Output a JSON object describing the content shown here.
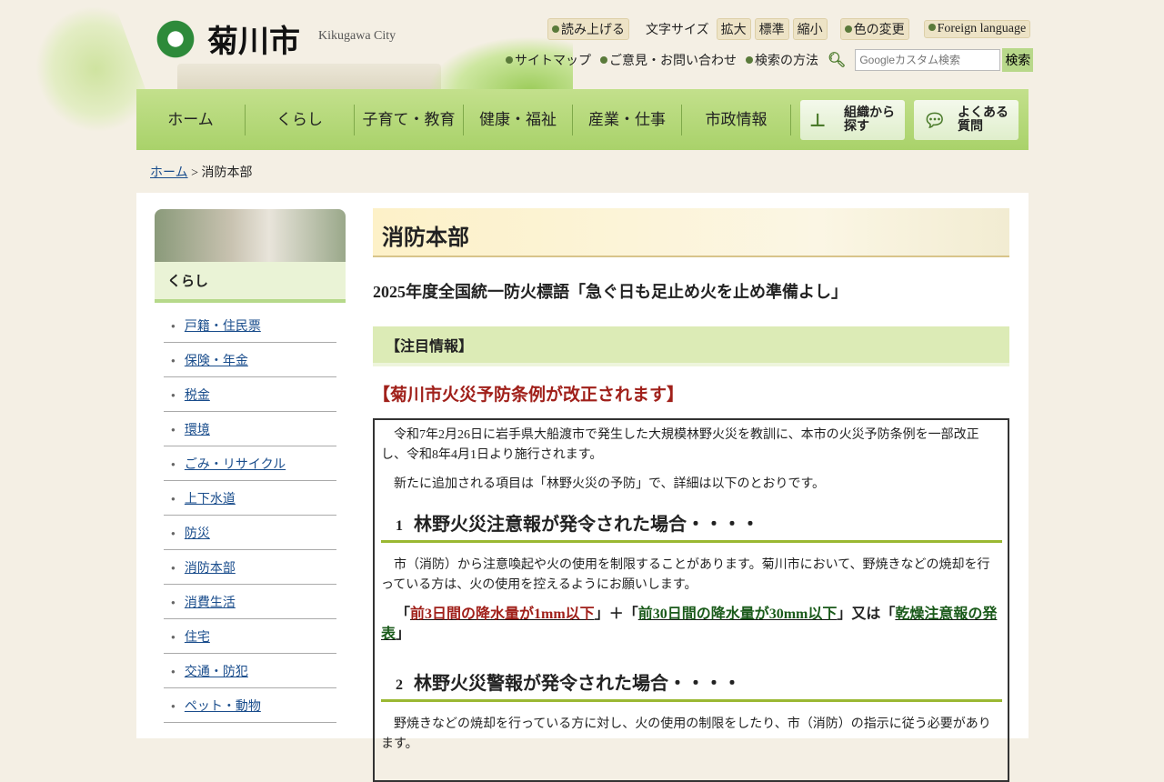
{
  "header": {
    "logo_text": "菊川市",
    "logo_en": "Kikugawa City",
    "read_aloud": "読み上げる",
    "font_size_label": "文字サイズ",
    "font_large": "拡大",
    "font_normal": "標準",
    "font_small": "縮小",
    "color_change": "色の変更",
    "foreign": "Foreign language",
    "sitemap": "サイトマップ",
    "contact": "ご意見・お問い合わせ",
    "search_help": "検索の方法",
    "search_placeholder": "Googleカスタム検索",
    "search_button": "検索"
  },
  "nav": {
    "items": [
      "ホーム",
      "くらし",
      "子育て・教育",
      "健康・福祉",
      "産業・仕事",
      "市政情報"
    ],
    "org": "組織から\n探す",
    "faq": "よくある\n質問"
  },
  "breadcrumb": {
    "home": "ホーム",
    "sep": " > ",
    "current": "消防本部"
  },
  "sidebar": {
    "title": "くらし",
    "items": [
      "戸籍・住民票",
      "保険・年金",
      "税金",
      "環境",
      "ごみ・リサイクル",
      "上下水道",
      "防災",
      "消防本部",
      "消費生活",
      "住宅",
      "交通・防犯",
      "ペット・動物"
    ]
  },
  "main": {
    "title": "消防本部",
    "slogan": "2025年度全国統一防火標語「急ぐ日も足止め火を止め準備よし」",
    "section": "【注目情報】",
    "notice": "【菊川市火災予防条例が改正されます】",
    "p1": "令和7年2月26日に岩手県大船渡市で発生した大規模林野火災を教訓に、本市の火災予防条例を一部改正し、令和8年4月1日より施行されます。",
    "p2": "新たに追加される項目は「林野火災の予防」で、詳細は以下のとおりです。",
    "h1_num": "1",
    "h1": "林野火災注意報が発令された場合・・・・",
    "p3": "市（消防）から注意喚起や火の使用を制限することがあります。菊川市において、野焼きなどの焼却を行っている方は、火の使用を控えるようにお願いします。",
    "c_open1": "「",
    "c1": "前3日間の降水量が1mm以下",
    "c_close1": "」＋「",
    "c2": "前30日間の降水量が30mm以下",
    "c_close2": "」又は「",
    "c3": "乾燥注意報の発表",
    "c_close3": "」",
    "h2_num": "2",
    "h2": "林野火災警報が発令された場合・・・・",
    "p4": "野焼きなどの焼却を行っている方に対し、火の使用の制限をしたり、市（消防）の指示に従う必要があります。"
  }
}
